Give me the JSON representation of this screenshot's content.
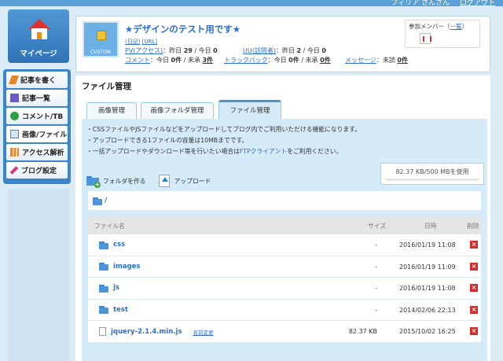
{
  "header_user": {
    "name": "フィリア さんさん",
    "logout": "ログアウト"
  },
  "mypage": {
    "label": "マイページ"
  },
  "sidebar": {
    "items": [
      {
        "label": "記事を書く",
        "icon": "pencil-icon",
        "color": "#e8862b"
      },
      {
        "label": "記事一覧",
        "icon": "document-list-icon",
        "color": "#6a5acd"
      },
      {
        "label": "コメント/TB",
        "icon": "speech-bubble-icon",
        "color": "#2f9e44"
      },
      {
        "label": "画像/ファイル",
        "icon": "image-icon",
        "color": "#3a86d4"
      },
      {
        "label": "アクセス解析",
        "icon": "bar-chart-icon",
        "color": "#e8862b"
      },
      {
        "label": "ブログ設定",
        "icon": "wrench-icon",
        "color": "#d63384"
      }
    ]
  },
  "blog": {
    "title": "★デザインのテスト用です★",
    "custom_label": "CUSTOM",
    "link_diary": "(日記)",
    "link_url": "[URL]",
    "pv_label": "PV(アクセス)",
    "pv_text": "：昨日",
    "pv_yesterday": "29",
    "pv_today_text": "/ 今日",
    "pv_today": "0",
    "uu_label": "UU(訪問者)",
    "uu_text": "：昨日",
    "uu_yesterday": "2",
    "uu_today_text": "/ 今日",
    "uu_today": "0",
    "comment_label": "コメント",
    "comment_text": "：今日",
    "comment_today": "0件",
    "comment_unapproved_text": "/ 未承",
    "comment_unapproved": "3件",
    "trackback_label": "トラックバック",
    "trackback_text": "：今日",
    "trackback_today": "0件",
    "trackback_unapproved_text": "/ 未承",
    "trackback_unapproved": "0件",
    "message_label": "メッセージ",
    "message_text": "：未読",
    "message_unread": "0件"
  },
  "members": {
    "label": "参加メンバー（",
    "link": "一覧",
    "close": "）"
  },
  "page": {
    "title": "ファイル管理"
  },
  "tabs": [
    {
      "label": "画像管理"
    },
    {
      "label": "画像フォルダ管理"
    },
    {
      "label": "ファイル管理"
    }
  ],
  "info": {
    "line1": "・CSSファイルやJSファイルなどをアップロードしてブログ内でご利用いただける機能になります。",
    "line2": "・アップロードできる1ファイルの容量は10MBまでです。",
    "line3_pre": "・一括アップロードやダウンロード等を行いたい場合は",
    "line3_link": "FTPクライアント",
    "line3_post": "をご利用ください。"
  },
  "usage": {
    "text": "82.37 KB/500 MBを使用",
    "fraction": 0.0002
  },
  "actions": {
    "create_folder": "フォルダを作る",
    "upload": "アップロード"
  },
  "path": {
    "current": "/"
  },
  "table": {
    "headers": {
      "name": "ファイル名",
      "size": "サイズ",
      "date": "日時",
      "delete": "削除"
    },
    "rows": [
      {
        "type": "folder",
        "name": "css",
        "size": "-",
        "date": "2016/01/19 11:08"
      },
      {
        "type": "folder",
        "name": "images",
        "size": "-",
        "date": "2016/01/19 11:09"
      },
      {
        "type": "folder",
        "name": "js",
        "size": "-",
        "date": "2016/01/19 11:08"
      },
      {
        "type": "folder",
        "name": "test",
        "size": "-",
        "date": "2014/02/06 22:13"
      },
      {
        "type": "file",
        "name": "jquery-2.1.4.min.js",
        "rename": "名前変更",
        "size": "82.37 KB",
        "date": "2015/10/02 16:25"
      }
    ],
    "delete_symbol": "×"
  }
}
